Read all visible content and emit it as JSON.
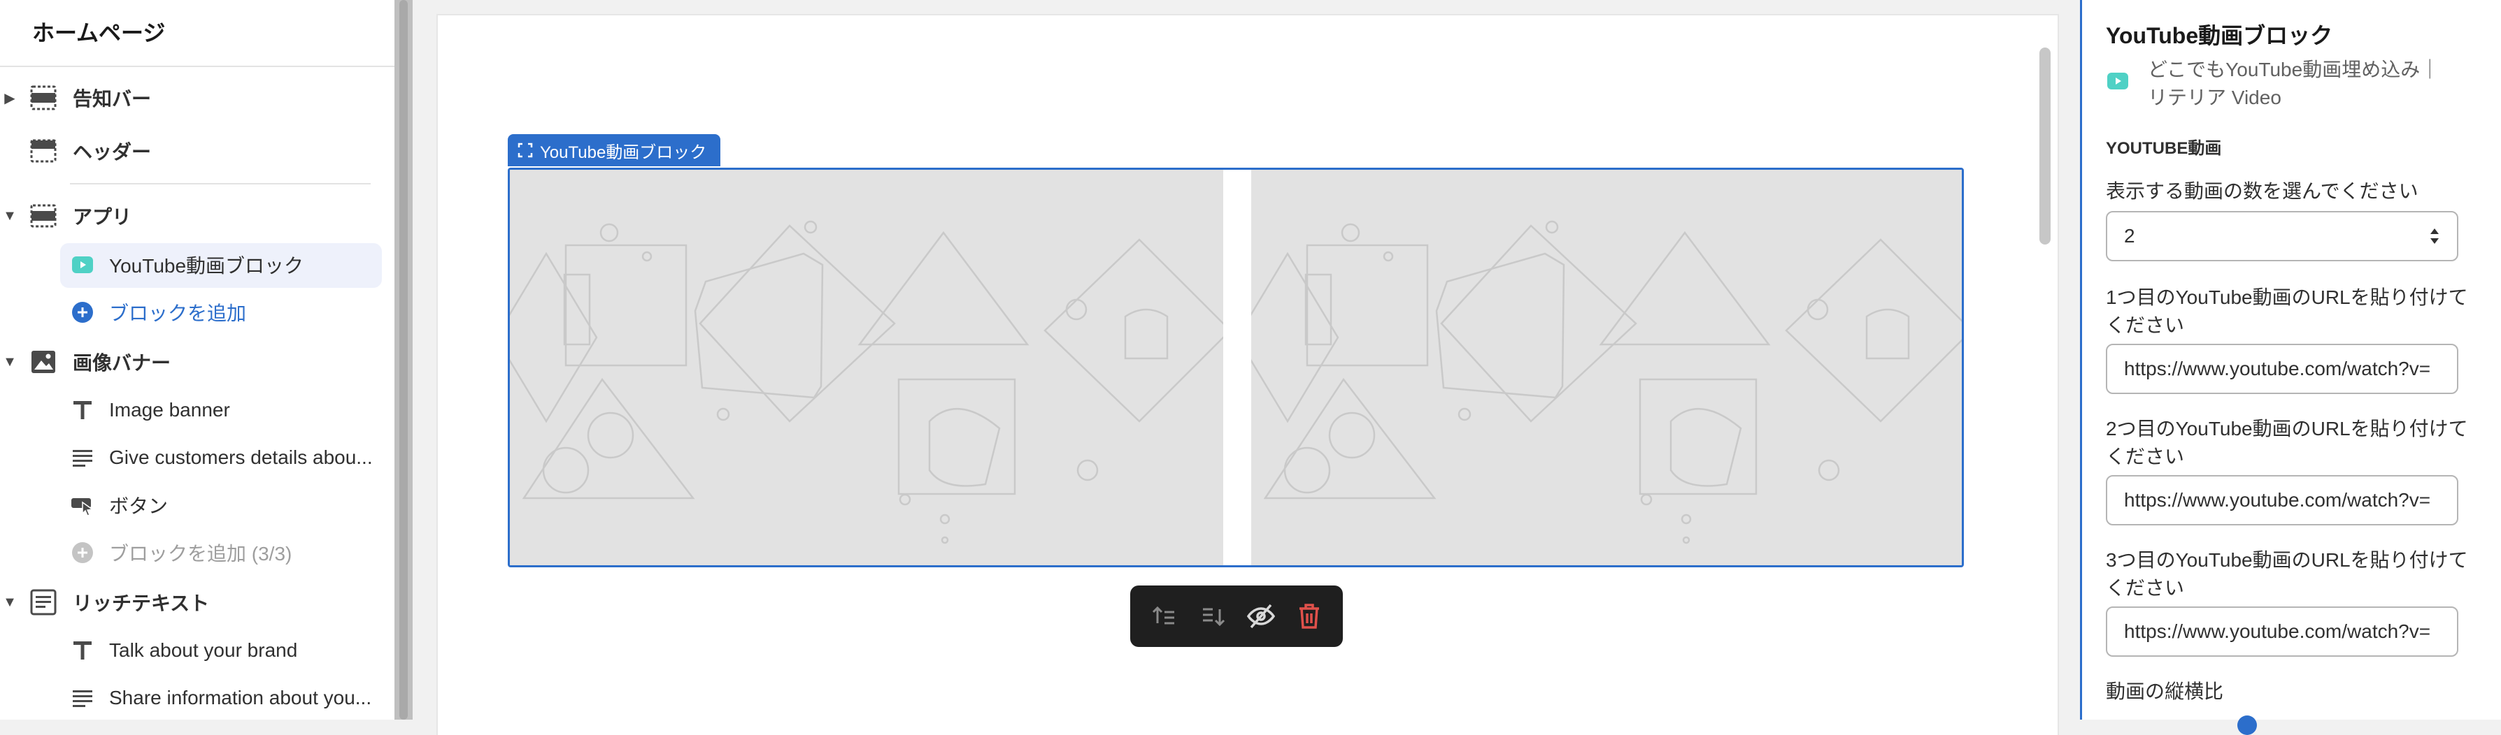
{
  "sidebar": {
    "title": "ホームページ",
    "items": [
      {
        "label": "告知バー"
      },
      {
        "label": "ヘッダー"
      },
      {
        "label": "アプリ"
      },
      {
        "label": "YouTube動画ブロック"
      },
      {
        "label": "ブロックを追加"
      },
      {
        "label": "画像バナー"
      },
      {
        "label": "Image banner"
      },
      {
        "label": "Give customers details abou..."
      },
      {
        "label": "ボタン"
      },
      {
        "label": "ブロックを追加 (3/3)"
      },
      {
        "label": "リッチテキスト"
      },
      {
        "label": "Talk about your brand"
      },
      {
        "label": "Share information about you..."
      }
    ]
  },
  "canvas": {
    "block_tag": "YouTube動画ブロック"
  },
  "toolbar": {
    "icons": [
      "move-up-icon",
      "move-down-icon",
      "hide-icon",
      "delete-icon"
    ]
  },
  "panel": {
    "title": "YouTube動画ブロック",
    "app_name": "どこでもYouTube動画埋め込み｜リテリア Video",
    "section": "YOUTUBE動画",
    "count_label": "表示する動画の数を選んでください",
    "count_value": "2",
    "url1_label": "1つ目のYouTube動画のURLを貼り付けてください",
    "url1_value": "https://www.youtube.com/watch?v=",
    "url2_label": "2つ目のYouTube動画のURLを貼り付けてください",
    "url2_value": "https://www.youtube.com/watch?v=",
    "url3_label": "3つ目のYouTube動画のURLを貼り付けてください",
    "url3_value": "https://www.youtube.com/watch?v=",
    "aspect_label": "動画の縦横比"
  },
  "colors": {
    "accent": "#2c6ecb",
    "app_icon": "#4fd1c5",
    "delete": "#e0514b"
  }
}
